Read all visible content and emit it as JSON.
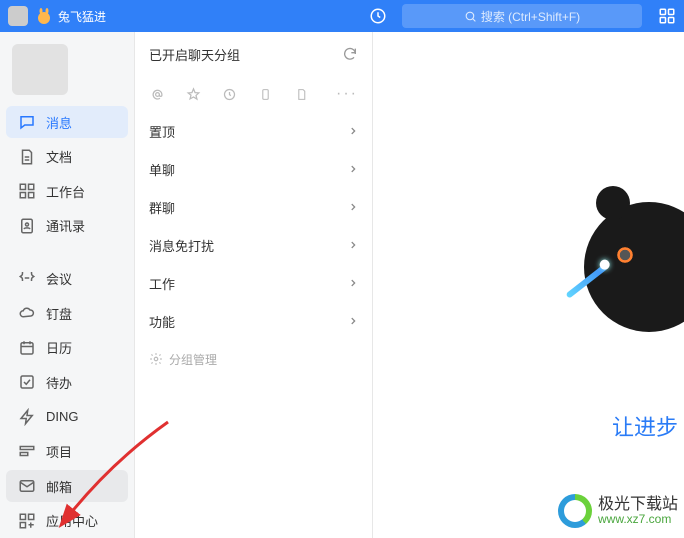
{
  "titlebar": {
    "app_title": "兔飞猛进",
    "search_placeholder": "搜索 (Ctrl+Shift+F)"
  },
  "sidebar": {
    "items": [
      {
        "label": "消息",
        "icon": "chat-icon",
        "active": true
      },
      {
        "label": "文档",
        "icon": "doc-icon"
      },
      {
        "label": "工作台",
        "icon": "workbench-icon"
      },
      {
        "label": "通讯录",
        "icon": "contacts-icon"
      },
      {
        "label": "会议",
        "icon": "meeting-icon"
      },
      {
        "label": "钉盘",
        "icon": "cloud-icon"
      },
      {
        "label": "日历",
        "icon": "calendar-icon"
      },
      {
        "label": "待办",
        "icon": "todo-icon"
      },
      {
        "label": "DING",
        "icon": "ding-icon"
      },
      {
        "label": "项目",
        "icon": "project-icon"
      },
      {
        "label": "邮箱",
        "icon": "mail-icon",
        "highlight": true
      },
      {
        "label": "应用中心",
        "icon": "appcenter-icon"
      }
    ]
  },
  "middle": {
    "header_text": "已开启聊天分组",
    "groups": [
      {
        "label": "置顶"
      },
      {
        "label": "单聊"
      },
      {
        "label": "群聊"
      },
      {
        "label": "消息免打扰"
      },
      {
        "label": "工作"
      },
      {
        "label": "功能"
      }
    ],
    "manage_label": "分组管理"
  },
  "content": {
    "slogan": "让进步",
    "watermark_name": "极光下载站",
    "watermark_url": "www.xz7.com"
  }
}
